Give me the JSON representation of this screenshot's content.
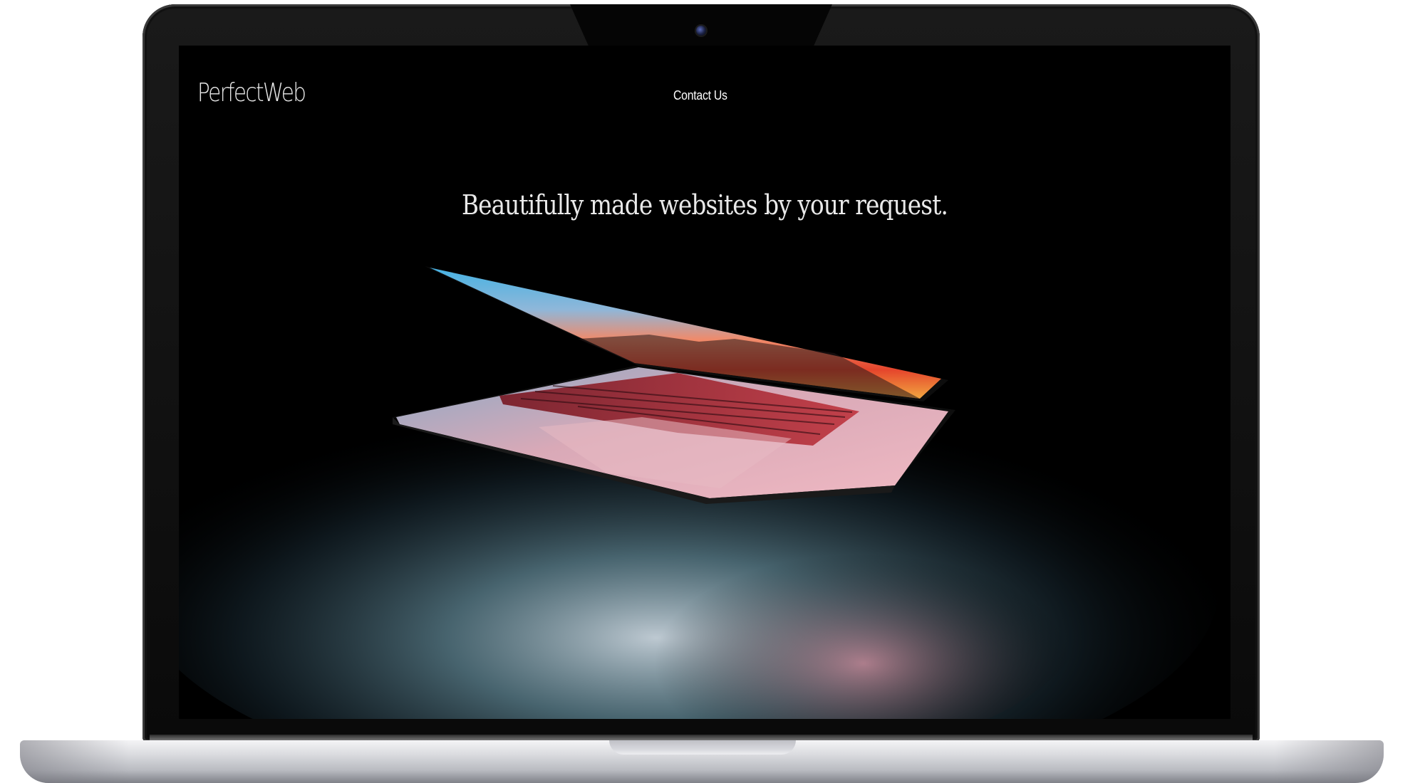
{
  "site": {
    "logo": "PerfectWeb",
    "nav": {
      "contact_label": "Contact Us"
    },
    "hero": {
      "title": "Beautifully made websites by your request."
    }
  },
  "icons": {
    "camera": "camera-icon"
  },
  "colors": {
    "screen_background": "#000000",
    "text": "#ffffff",
    "laptop_frame": "#111111",
    "laptop_base": "#d9dade"
  }
}
